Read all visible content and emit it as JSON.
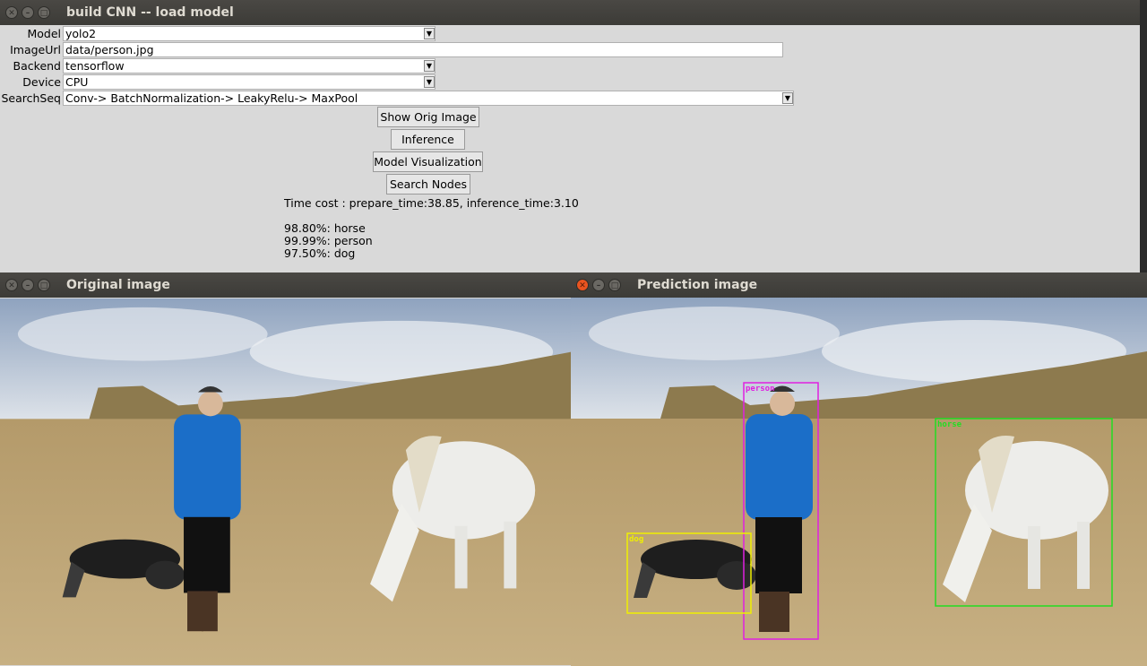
{
  "main_window": {
    "title": "build CNN -- load model",
    "form": {
      "model": {
        "label": "Model",
        "value": "yolo2"
      },
      "image_url": {
        "label": "ImageUrl",
        "value": "data/person.jpg"
      },
      "backend": {
        "label": "Backend",
        "value": "tensorflow"
      },
      "device": {
        "label": "Device",
        "value": "CPU"
      },
      "search_seq": {
        "label": "SearchSeq",
        "value": "Conv-> BatchNormalization-> LeakyRelu-> MaxPool"
      }
    },
    "buttons": {
      "show_orig": "Show Orig Image",
      "inference": "Inference",
      "model_vis": "Model Visualization",
      "search_nodes": "Search Nodes"
    },
    "time_cost": "Time cost : prepare_time:38.85, inference_time:3.10",
    "results": [
      "98.80%: horse",
      "99.99%: person",
      "97.50%: dog"
    ]
  },
  "original_window": {
    "title": "Original image"
  },
  "prediction_window": {
    "title": "Prediction image",
    "detections": [
      {
        "label": "person",
        "color": "#e020e0"
      },
      {
        "label": "horse",
        "color": "#22dd22"
      },
      {
        "label": "dog",
        "color": "#f0f000"
      }
    ]
  },
  "colors": {
    "titlebar": "#3c3b37",
    "panel": "#d9d9d9",
    "close_active": "#e95420"
  }
}
